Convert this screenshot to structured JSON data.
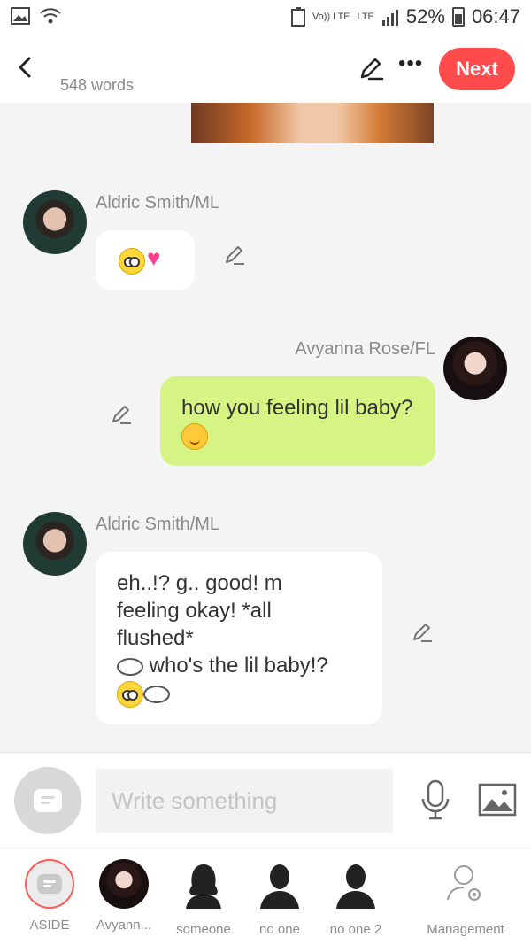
{
  "status_bar": {
    "network_small": "Vo)) LTE",
    "lte": "LTE",
    "battery": "52%",
    "time": "06:47"
  },
  "header": {
    "word_count": "548 words",
    "next_label": "Next"
  },
  "messages": [
    {
      "sender": "Aldric Smith/ML",
      "side": "left",
      "text": ""
    },
    {
      "sender": "Avyanna Rose/FL",
      "side": "right",
      "text": "how you feeling lil baby?"
    },
    {
      "sender": "Aldric Smith/ML",
      "side": "left",
      "line1": "eh..!? g.. good! m",
      "line2": "feeling okay! *all",
      "line3": "flushed*",
      "line4": "who's the lil baby!?"
    }
  ],
  "composer": {
    "placeholder": "Write something"
  },
  "tabs": [
    {
      "label": "ASIDE"
    },
    {
      "label": "Avyann..."
    },
    {
      "label": "someone"
    },
    {
      "label": "no one"
    },
    {
      "label": "no one 2"
    },
    {
      "label": "Management"
    }
  ],
  "colors": {
    "accent": "#ff4b4b",
    "bubble_green": "#d6f484",
    "bubble_white": "#ffffff",
    "name_gray": "#8b8b8b"
  },
  "icons": [
    "back-icon",
    "edit-icon",
    "more-icon",
    "mic-icon",
    "image-icon",
    "aside-icon",
    "management-icon"
  ]
}
